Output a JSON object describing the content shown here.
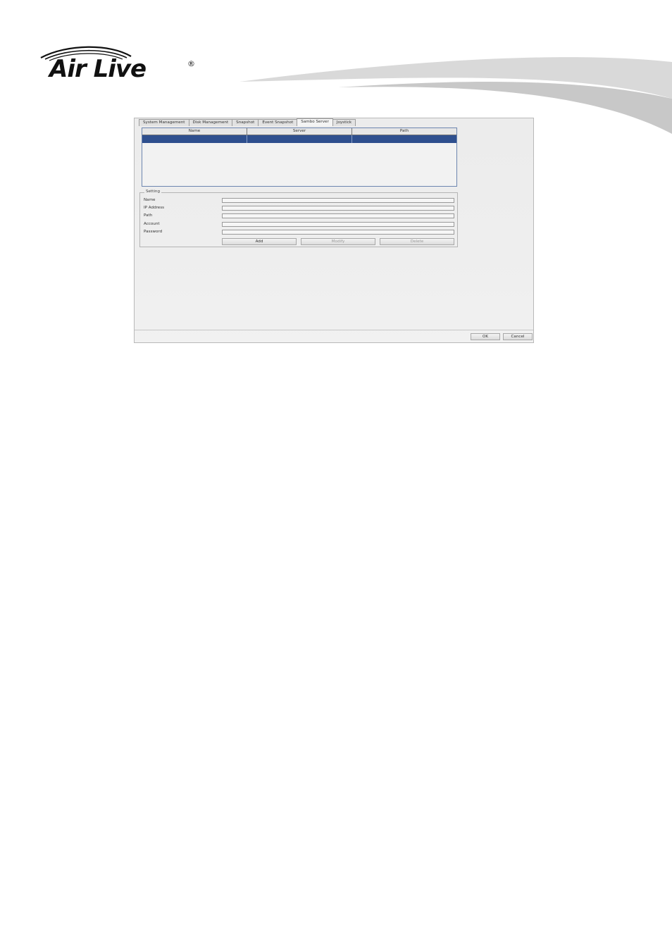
{
  "brand": {
    "logo_text": "Air Live",
    "registered": "®"
  },
  "tabs": [
    {
      "label": "System Management"
    },
    {
      "label": "Disk Management"
    },
    {
      "label": "Snapshot"
    },
    {
      "label": "Event Snapshot"
    },
    {
      "label": "Sambo Server",
      "active": true
    },
    {
      "label": "Joystick"
    }
  ],
  "table": {
    "columns": [
      "Name",
      "Server",
      "Path"
    ],
    "selected_row": [
      "",
      "",
      ""
    ]
  },
  "settings": {
    "title": "Setting",
    "fields": [
      {
        "label": "Name",
        "value": ""
      },
      {
        "label": "IP Address",
        "value": ""
      },
      {
        "label": "Path",
        "value": ""
      },
      {
        "label": "Account",
        "value": ""
      },
      {
        "label": "Password",
        "value": ""
      }
    ],
    "buttons": {
      "add": "Add",
      "modify": "Modify",
      "delete": "Delete"
    }
  },
  "footer": {
    "ok": "OK",
    "cancel": "Cancel"
  },
  "colors": {
    "selection": "#2e4f8e",
    "table_border": "#6d86b0"
  }
}
